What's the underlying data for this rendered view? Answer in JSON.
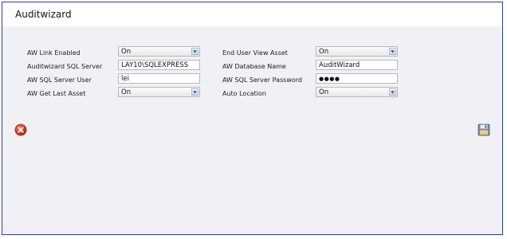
{
  "window": {
    "title": "Auditwizard"
  },
  "form": {
    "aw_link_enabled": {
      "label": "AW Link Enabled",
      "value": "On"
    },
    "auditwizard_sql_server": {
      "label": "Auditwizard SQL Server",
      "value": "LAY10\\SQLEXPRESS"
    },
    "aw_sql_server_user": {
      "label": "AW SQL Server User",
      "value": "lei"
    },
    "aw_get_last_asset": {
      "label": "AW Get Last Asset",
      "value": "On"
    },
    "end_user_view_asset": {
      "label": "End User View Asset",
      "value": "On"
    },
    "aw_database_name": {
      "label": "AW Database Name",
      "value": "AuditWizard"
    },
    "aw_sql_server_password": {
      "label": "AW SQL Server Password",
      "value": "●●●●"
    },
    "auto_location": {
      "label": "Auto Location",
      "value": "On"
    }
  },
  "actions": {
    "cancel_icon": "close-circle-icon",
    "save_icon": "floppy-disk-icon"
  },
  "colors": {
    "frame_border": "#2f3f8f",
    "cancel_red": "#d9361b",
    "save_blue": "#5a7fa8"
  }
}
